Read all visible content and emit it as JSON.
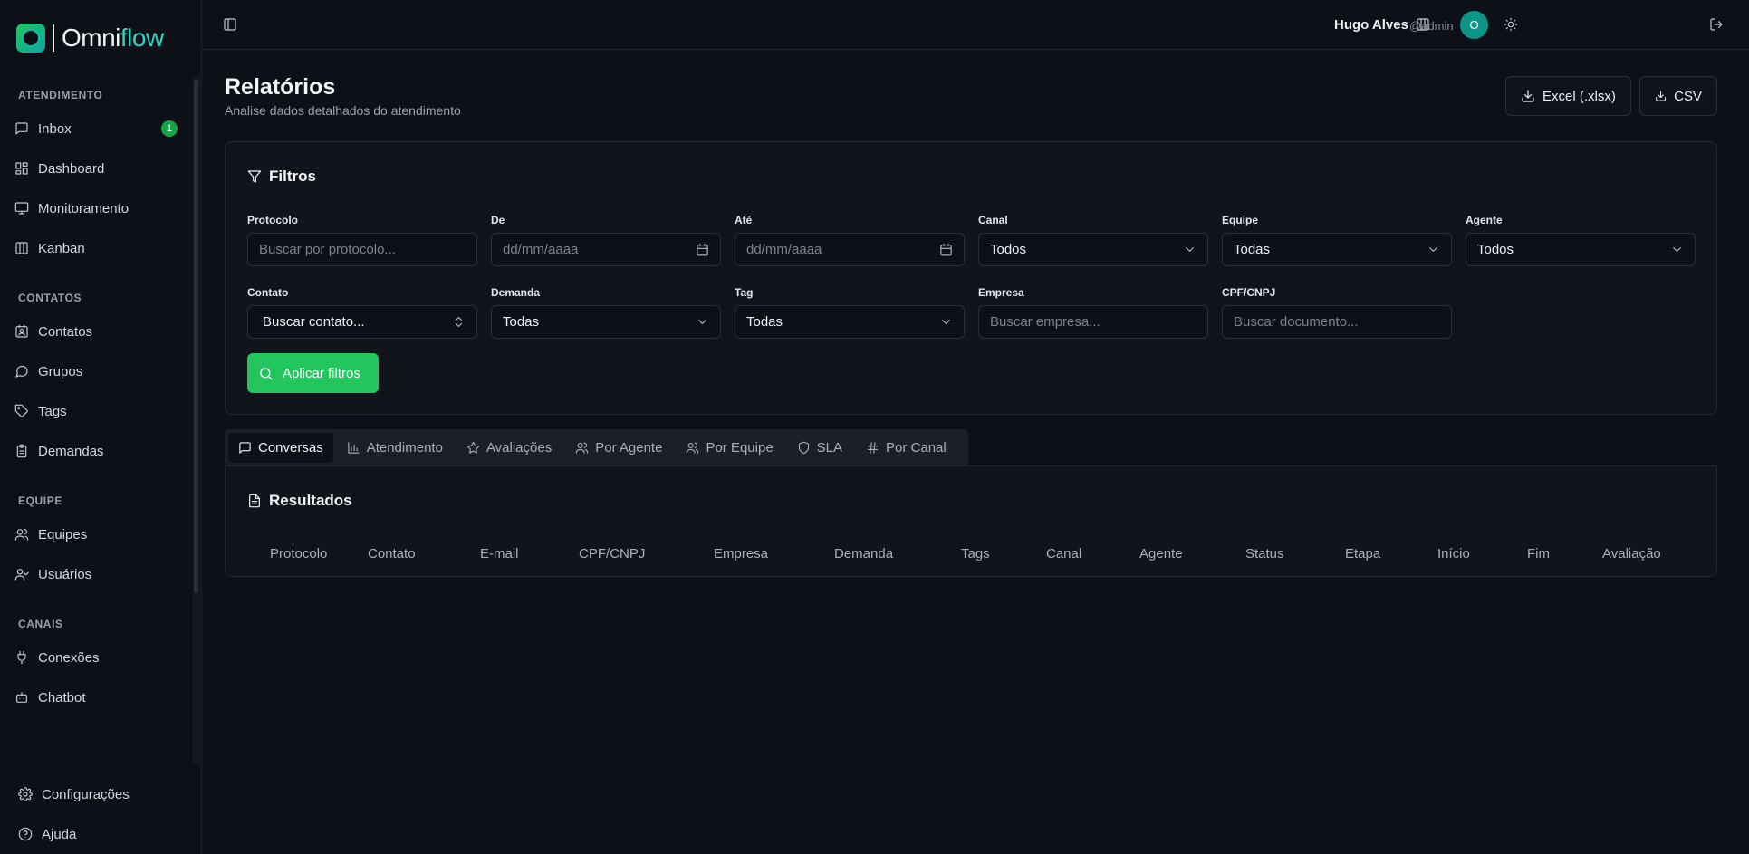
{
  "brand": {
    "name_part1": "Omni",
    "name_part2": "flow"
  },
  "sidebar": {
    "sections": [
      {
        "title": "ATENDIMENTO",
        "items": [
          {
            "label": "Inbox",
            "icon": "message-square-icon",
            "badge": "1"
          },
          {
            "label": "Dashboard",
            "icon": "layout-dashboard-icon"
          },
          {
            "label": "Monitoramento",
            "icon": "monitor-icon"
          },
          {
            "label": "Kanban",
            "icon": "columns-icon"
          }
        ]
      },
      {
        "title": "CONTATOS",
        "items": [
          {
            "label": "Contatos",
            "icon": "contact-icon"
          },
          {
            "label": "Grupos",
            "icon": "message-circle-icon"
          },
          {
            "label": "Tags",
            "icon": "tag-icon"
          },
          {
            "label": "Demandas",
            "icon": "clipboard-icon"
          }
        ]
      },
      {
        "title": "EQUIPE",
        "items": [
          {
            "label": "Equipes",
            "icon": "users-icon"
          },
          {
            "label": "Usuários",
            "icon": "user-icon"
          }
        ]
      },
      {
        "title": "CANAIS",
        "items": [
          {
            "label": "Conexões",
            "icon": "plug-icon"
          },
          {
            "label": "Chatbot",
            "icon": "bot-icon"
          }
        ]
      }
    ],
    "bottom": [
      {
        "label": "Configurações",
        "icon": "gear-icon"
      },
      {
        "label": "Ajuda",
        "icon": "help-circle-icon"
      }
    ]
  },
  "header": {
    "user_name": "Hugo Alves",
    "user_handle": "@admin",
    "avatar_initial": "O"
  },
  "page": {
    "title": "Relatórios",
    "subtitle": "Analise dados detalhados do atendimento",
    "export_excel": "Excel (.xlsx)",
    "export_csv": "CSV"
  },
  "filters": {
    "title": "Filtros",
    "protocolo": {
      "label": "Protocolo",
      "placeholder": "Buscar por protocolo..."
    },
    "de": {
      "label": "De",
      "placeholder": "dd/mm/aaaa"
    },
    "ate": {
      "label": "Até",
      "placeholder": "dd/mm/aaaa"
    },
    "canal": {
      "label": "Canal",
      "value": "Todos"
    },
    "equipe": {
      "label": "Equipe",
      "value": "Todas"
    },
    "agente": {
      "label": "Agente",
      "value": "Todos"
    },
    "contato": {
      "label": "Contato",
      "value": "Buscar contato..."
    },
    "demanda": {
      "label": "Demanda",
      "value": "Todas"
    },
    "tag": {
      "label": "Tag",
      "value": "Todas"
    },
    "empresa": {
      "label": "Empresa",
      "placeholder": "Buscar empresa..."
    },
    "cpf": {
      "label": "CPF/CNPJ",
      "placeholder": "Buscar documento..."
    },
    "apply": "Aplicar filtros"
  },
  "tabs": [
    "Conversas",
    "Atendimento",
    "Avaliações",
    "Por Agente",
    "Por Equipe",
    "SLA",
    "Por Canal"
  ],
  "results": {
    "title": "Resultados",
    "columns": [
      "Protocolo",
      "Contato",
      "E-mail",
      "CPF/CNPJ",
      "Empresa",
      "Demanda",
      "Tags",
      "Canal",
      "Agente",
      "Status",
      "Etapa",
      "Início",
      "Fim",
      "Avaliação"
    ]
  },
  "colors": {
    "accent": "#22c55e",
    "avatar": "#0d9488",
    "background": "#0d1017"
  }
}
